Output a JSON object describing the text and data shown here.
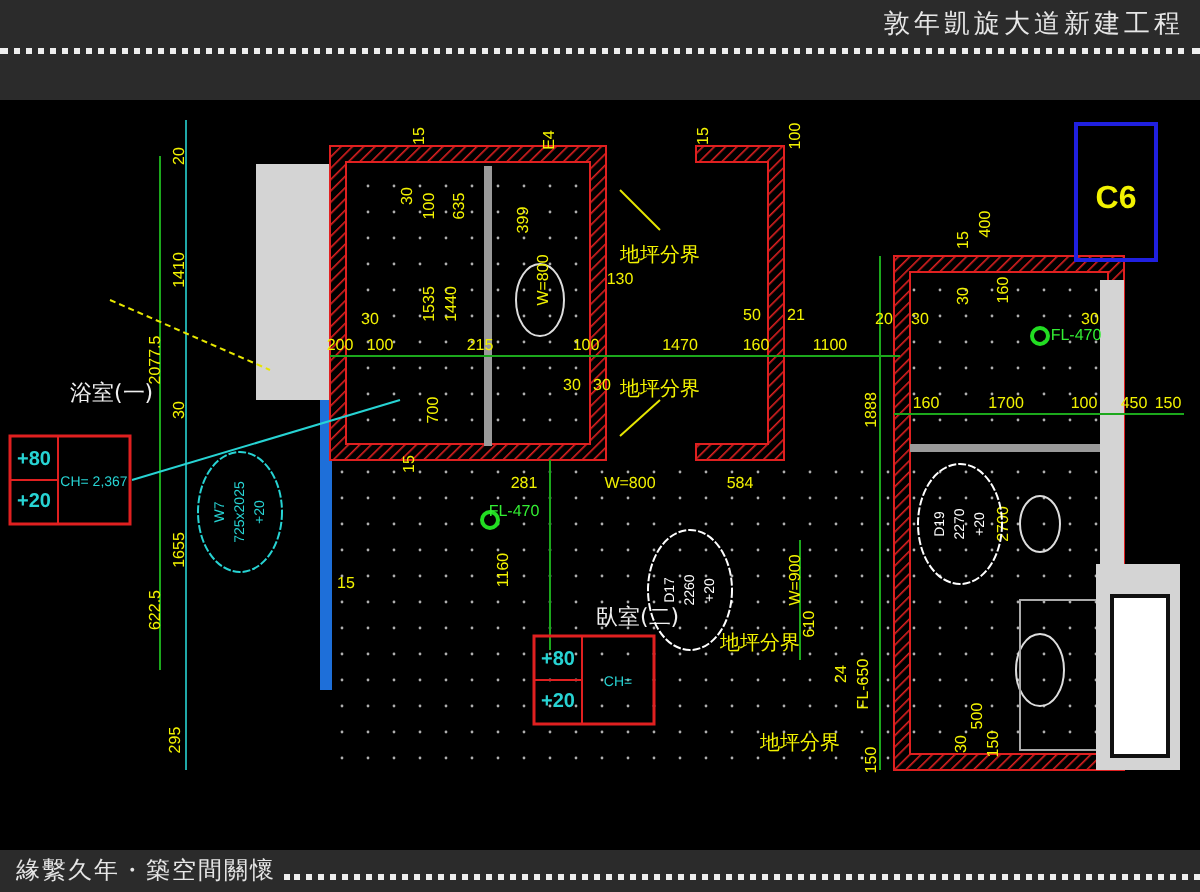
{
  "header": {
    "title": "敦年凱旋大道新建工程"
  },
  "drawing": {
    "rooms": [
      "浴室(一)",
      "臥室(二)"
    ],
    "tag": "C6",
    "legends": [
      {
        "top": "+80",
        "bottom": "+20",
        "ch": "CH= 2,367"
      },
      {
        "top": "+80",
        "bottom": "+20",
        "ch": "CH="
      }
    ],
    "door_tags": [
      {
        "lines": [
          "W7",
          "725x2025",
          "+20"
        ]
      },
      {
        "lines": [
          "D17",
          "2260",
          "+20"
        ]
      },
      {
        "lines": [
          "D19",
          "2270",
          "+20"
        ]
      }
    ],
    "labels": [
      {
        "text": "20",
        "kind": "dim"
      },
      {
        "text": "1410",
        "kind": "dim"
      },
      {
        "text": "2077.5",
        "kind": "dim"
      },
      {
        "text": "30",
        "kind": "dim"
      },
      {
        "text": "1655",
        "kind": "dim"
      },
      {
        "text": "622.5",
        "kind": "dim"
      },
      {
        "text": "295",
        "kind": "dim"
      },
      {
        "text": "15",
        "kind": "dim"
      },
      {
        "text": "E4",
        "kind": "dim"
      },
      {
        "text": "15",
        "kind": "dim"
      },
      {
        "text": "100",
        "kind": "dim"
      },
      {
        "text": "30",
        "kind": "dim"
      },
      {
        "text": "100",
        "kind": "dim"
      },
      {
        "text": "635",
        "kind": "dim"
      },
      {
        "text": "1535",
        "kind": "dim"
      },
      {
        "text": "1440",
        "kind": "dim"
      },
      {
        "text": "399",
        "kind": "dim"
      },
      {
        "text": "W=800",
        "kind": "dim"
      },
      {
        "text": "130",
        "kind": "dim"
      },
      {
        "text": "30",
        "kind": "dim"
      },
      {
        "text": "50",
        "kind": "dim"
      },
      {
        "text": "21",
        "kind": "dim"
      },
      {
        "text": "200",
        "kind": "dim"
      },
      {
        "text": "100",
        "kind": "dim"
      },
      {
        "text": "215",
        "kind": "dim"
      },
      {
        "text": "100",
        "kind": "dim"
      },
      {
        "text": "1470",
        "kind": "dim"
      },
      {
        "text": "160",
        "kind": "dim"
      },
      {
        "text": "1100",
        "kind": "dim"
      },
      {
        "text": "30",
        "kind": "dim"
      },
      {
        "text": "30",
        "kind": "dim"
      },
      {
        "text": "700",
        "kind": "dim"
      },
      {
        "text": "15",
        "kind": "dim"
      },
      {
        "text": "281",
        "kind": "dim"
      },
      {
        "text": "W=800",
        "kind": "dim"
      },
      {
        "text": "584",
        "kind": "dim"
      },
      {
        "text": "1160",
        "kind": "dim"
      },
      {
        "text": "W=900",
        "kind": "dim"
      },
      {
        "text": "610",
        "kind": "dim"
      },
      {
        "text": "15",
        "kind": "dim"
      },
      {
        "text": "400",
        "kind": "dim"
      },
      {
        "text": "15",
        "kind": "dim"
      },
      {
        "text": "30",
        "kind": "dim"
      },
      {
        "text": "160",
        "kind": "dim"
      },
      {
        "text": "20",
        "kind": "dim"
      },
      {
        "text": "30",
        "kind": "dim"
      },
      {
        "text": "30",
        "kind": "dim"
      },
      {
        "text": "1888",
        "kind": "dim"
      },
      {
        "text": "160",
        "kind": "dim"
      },
      {
        "text": "1700",
        "kind": "dim"
      },
      {
        "text": "100",
        "kind": "dim"
      },
      {
        "text": "450",
        "kind": "dim"
      },
      {
        "text": "150",
        "kind": "dim"
      },
      {
        "text": "2700",
        "kind": "dim"
      },
      {
        "text": "24",
        "kind": "dim"
      },
      {
        "text": "FL-650",
        "kind": "dim"
      },
      {
        "text": "150",
        "kind": "dim"
      },
      {
        "text": "500",
        "kind": "dim"
      },
      {
        "text": "30",
        "kind": "dim"
      },
      {
        "text": "150",
        "kind": "dim"
      },
      {
        "text": "FL-470",
        "kind": "level"
      },
      {
        "text": "FL-470",
        "kind": "level"
      },
      {
        "text": "地坪分界",
        "kind": "note"
      },
      {
        "text": "地坪分界",
        "kind": "note"
      },
      {
        "text": "地坪分界",
        "kind": "note"
      },
      {
        "text": "地坪分界",
        "kind": "note"
      }
    ]
  },
  "footer": {
    "text": "緣繫久年・築空間關懷"
  }
}
